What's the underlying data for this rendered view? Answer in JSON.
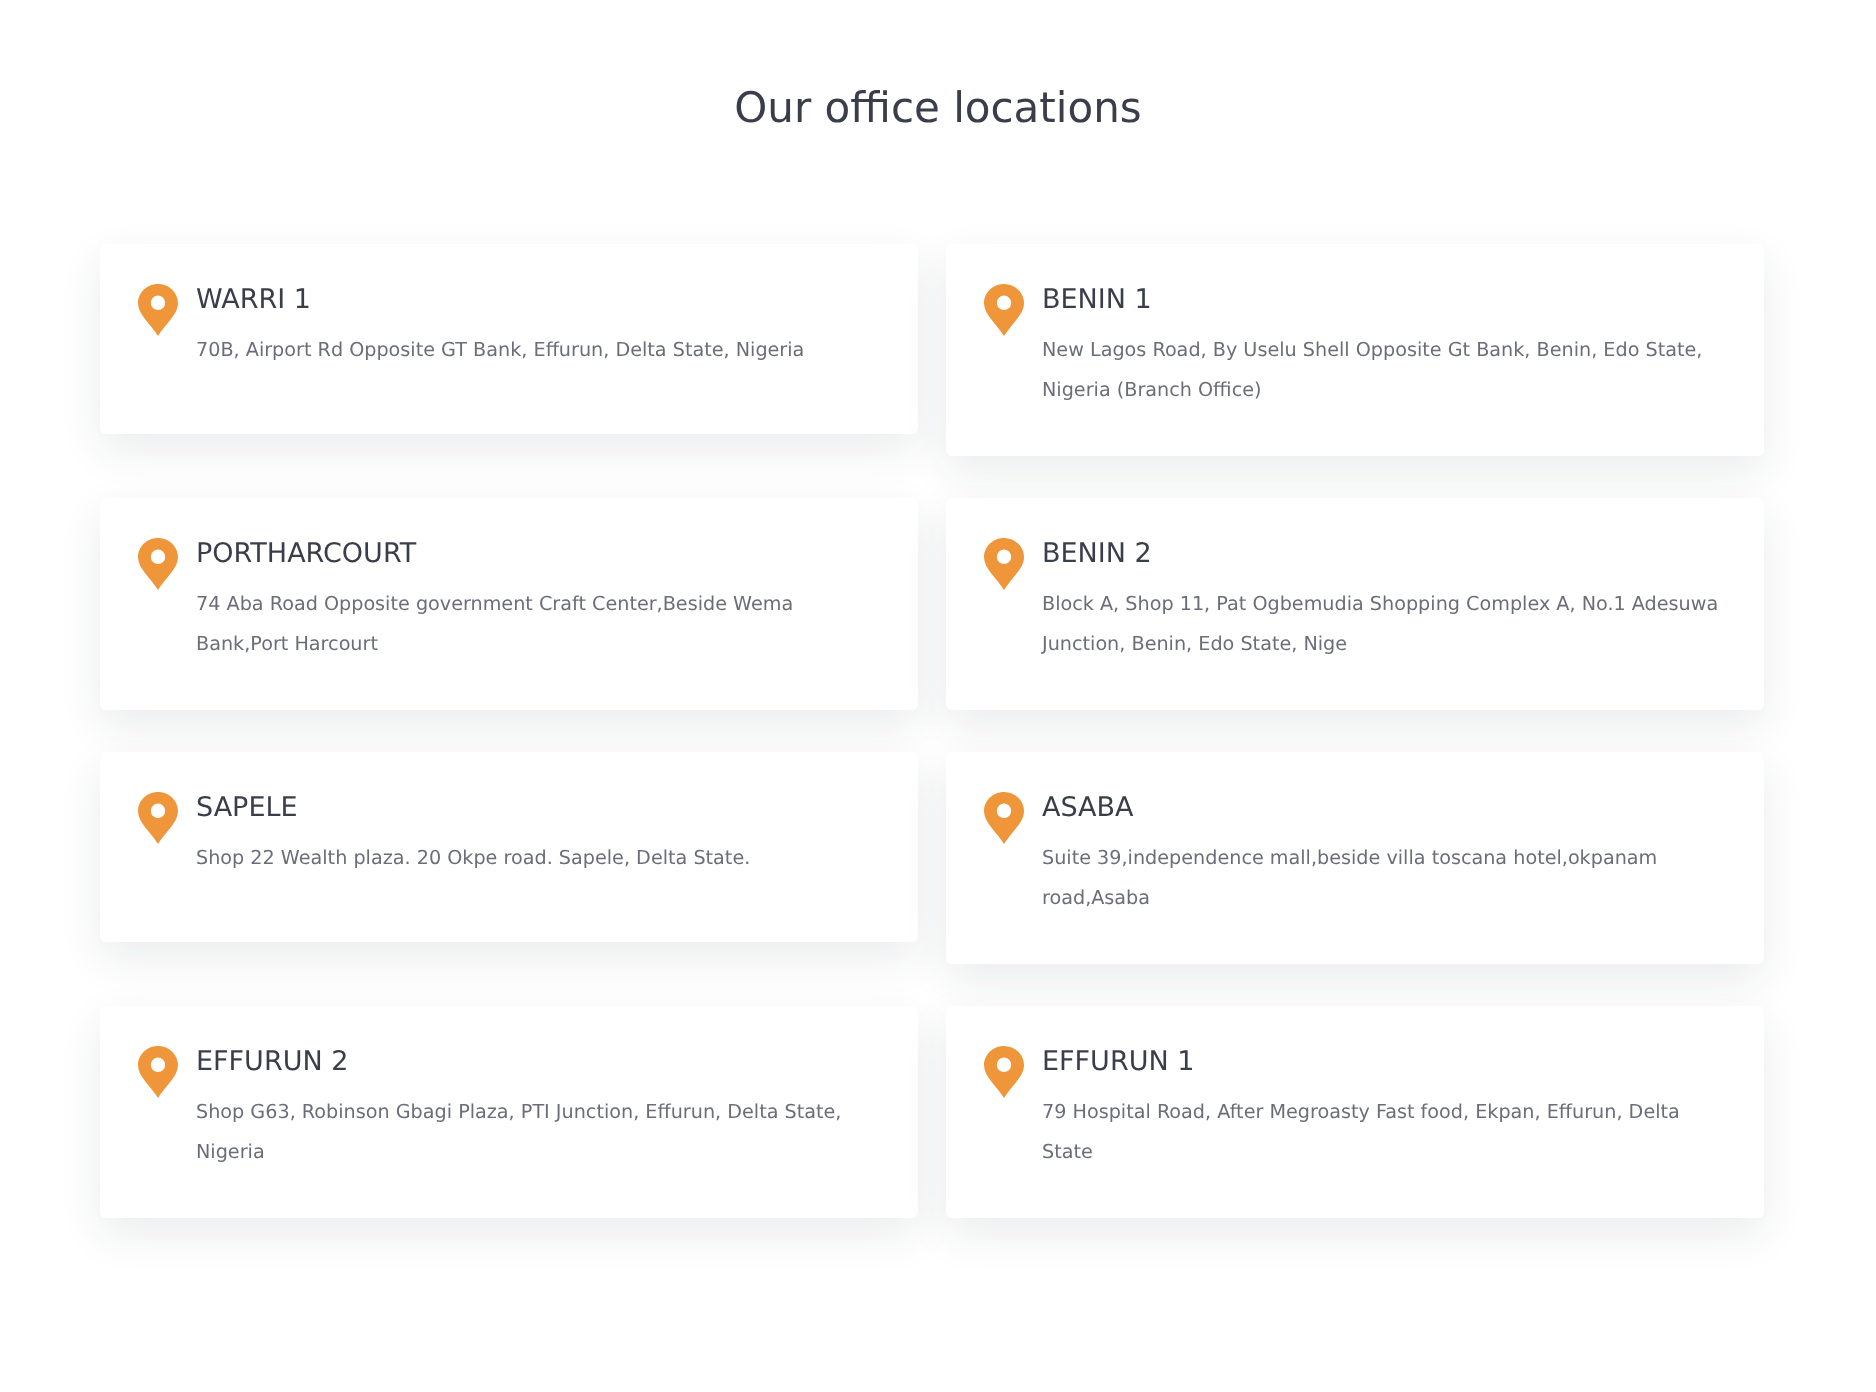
{
  "heading": "Our office locations",
  "offices": [
    {
      "name": "WARRI 1",
      "address": "70B, Airport Rd Opposite GT Bank, Effurun, Delta State, Nigeria"
    },
    {
      "name": "BENIN 1",
      "address": "New Lagos Road, By Uselu Shell Opposite Gt Bank, Benin, Edo State, Nigeria (Branch Office)"
    },
    {
      "name": "PORTHARCOURT",
      "address": "74 Aba Road Opposite government Craft Center,Beside Wema Bank,Port Harcourt"
    },
    {
      "name": "BENIN 2",
      "address": "Block A, Shop 11, Pat Ogbemudia Shopping Complex A, No.1 Adesuwa Junction, Benin, Edo State, Nige"
    },
    {
      "name": "SAPELE",
      "address": "Shop 22 Wealth plaza. 20 Okpe road. Sapele, Delta State."
    },
    {
      "name": "ASABA",
      "address": "Suite 39,independence mall,beside villa toscana hotel,okpanam road,Asaba"
    },
    {
      "name": "EFFURUN 2",
      "address": "Shop G63, Robinson Gbagi Plaza, PTI Junction, Effurun, Delta State, Nigeria"
    },
    {
      "name": "EFFURUN 1",
      "address": "79 Hospital Road, After Megroasty Fast food, Ekpan, Effurun, Delta State"
    }
  ]
}
